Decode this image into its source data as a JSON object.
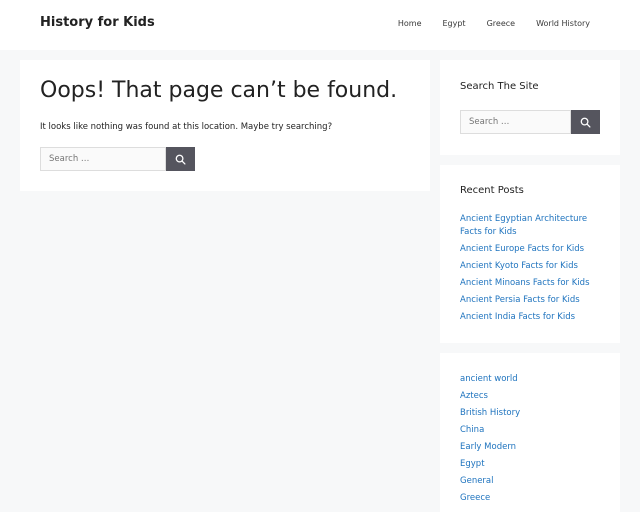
{
  "header": {
    "site_title": "History for Kids",
    "nav": [
      {
        "label": "Home"
      },
      {
        "label": "Egypt"
      },
      {
        "label": "Greece"
      },
      {
        "label": "World History"
      }
    ]
  },
  "main": {
    "title": "Oops! That page can’t be found.",
    "message": "It looks like nothing was found at this location. Maybe try searching?",
    "search": {
      "placeholder": "Search …",
      "icon": "search-icon"
    }
  },
  "sidebar": {
    "search_widget": {
      "title": "Search The Site",
      "placeholder": "Search …",
      "icon": "search-icon"
    },
    "recent_posts": {
      "title": "Recent Posts",
      "items": [
        {
          "label": "Ancient Egyptian Architecture Facts for Kids"
        },
        {
          "label": "Ancient Europe Facts for Kids"
        },
        {
          "label": "Ancient Kyoto Facts for Kids"
        },
        {
          "label": "Ancient Minoans Facts for Kids"
        },
        {
          "label": "Ancient Persia Facts for Kids"
        },
        {
          "label": "Ancient India Facts for Kids"
        }
      ]
    },
    "categories": {
      "items": [
        {
          "label": "ancient world"
        },
        {
          "label": "Aztecs"
        },
        {
          "label": "British History"
        },
        {
          "label": "China"
        },
        {
          "label": "Early Modern"
        },
        {
          "label": "Egypt"
        },
        {
          "label": "General"
        },
        {
          "label": "Greece"
        }
      ]
    }
  },
  "colors": {
    "link": "#1e73be",
    "button": "#55555e",
    "background": "#f7f8f9"
  }
}
